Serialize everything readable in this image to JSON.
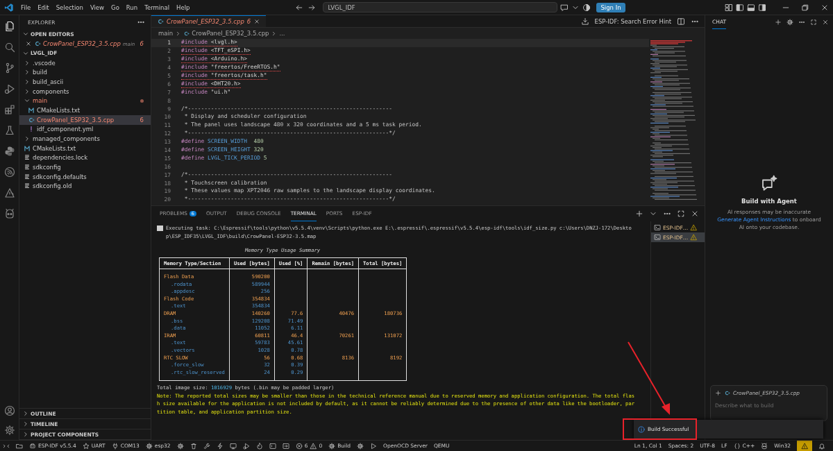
{
  "title_bar": {
    "menus": [
      "File",
      "Edit",
      "Selection",
      "View",
      "Go",
      "Run",
      "Terminal",
      "Help"
    ],
    "command_center": "LVGL_IDF",
    "sign_in": "Sign In"
  },
  "activity_bar": [
    {
      "selected": true
    },
    {
      "selected": false
    },
    {
      "selected": false
    },
    {
      "selected": false
    },
    {
      "selected": false
    },
    {
      "selected": false
    },
    {
      "selected": false
    },
    {
      "selected": false
    },
    {
      "selected": false
    },
    {
      "selected": false
    }
  ],
  "explorer": {
    "title": "EXPLORER",
    "open_editors": {
      "label": "OPEN EDITORS",
      "expanded": true,
      "items": [
        {
          "name": "CrowPanel_ESP32_3.5.cpp",
          "folder": "main",
          "badge": "6",
          "errors": true
        }
      ]
    },
    "workspace": {
      "label": "LVGL_IDF",
      "expanded": true,
      "children": [
        {
          "name": ".vscode",
          "kind": "folder",
          "expanded": false,
          "selected": false,
          "errors": false
        },
        {
          "name": "build",
          "kind": "folder",
          "expanded": false,
          "selected": false,
          "errors": false
        },
        {
          "name": "build_ascii",
          "kind": "folder",
          "expanded": false,
          "selected": false,
          "errors": false
        },
        {
          "name": "components",
          "kind": "folder",
          "expanded": false,
          "selected": false,
          "errors": false
        },
        {
          "name": "main",
          "kind": "folder",
          "expanded": true,
          "selected": false,
          "errors": true,
          "children": [
            {
              "name": "CMakeLists.txt",
              "kind": "cmake",
              "selected": false,
              "errors": false
            },
            {
              "name": "CrowPanel_ESP32_3.5.cpp",
              "kind": "cpp",
              "badge": "6",
              "selected": true,
              "errors": true
            },
            {
              "name": "idf_component.yml",
              "kind": "yaml",
              "selected": false,
              "errors": false
            }
          ]
        },
        {
          "name": "managed_components",
          "kind": "folder",
          "expanded": false,
          "selected": false,
          "errors": false
        },
        {
          "name": "CMakeLists.txt",
          "kind": "cmake",
          "selected": false,
          "errors": false
        },
        {
          "name": "dependencies.lock",
          "kind": "text",
          "selected": false,
          "errors": false
        },
        {
          "name": "sdkconfig",
          "kind": "text",
          "selected": false,
          "errors": false
        },
        {
          "name": "sdkconfig.defaults",
          "kind": "text",
          "selected": false,
          "errors": false
        },
        {
          "name": "sdkconfig.old",
          "kind": "text",
          "selected": false,
          "errors": false
        }
      ]
    },
    "sections": [
      {
        "label": "OUTLINE",
        "expanded": false
      },
      {
        "label": "TIMELINE",
        "expanded": false
      },
      {
        "label": "PROJECT COMPONENTS",
        "expanded": false
      }
    ]
  },
  "editor": {
    "tab": {
      "name": "CrowPanel_ESP32_3.5.cpp",
      "badge": "6",
      "errors": true
    },
    "hint_action": "ESP-IDF: Search Error Hint",
    "breadcrumbs": [
      "main",
      "CrowPanel_ESP32_3.5.cpp",
      "..."
    ],
    "lines": [
      {
        "number": "1",
        "current": true,
        "error": true,
        "tokens": [
          {
            "kind": "keyword",
            "text": "#include"
          },
          {
            "kind": "header",
            "text": " <lvgl.h>"
          }
        ]
      },
      {
        "number": "2",
        "current": false,
        "error": true,
        "tokens": [
          {
            "kind": "keyword",
            "text": "#include"
          },
          {
            "kind": "header",
            "text": " <TFT_eSPI.h>"
          }
        ]
      },
      {
        "number": "3",
        "current": false,
        "error": true,
        "tokens": [
          {
            "kind": "keyword",
            "text": "#include"
          },
          {
            "kind": "header",
            "text": " <Arduino.h>"
          }
        ]
      },
      {
        "number": "4",
        "current": false,
        "error": true,
        "tokens": [
          {
            "kind": "keyword",
            "text": "#include"
          },
          {
            "kind": "header",
            "text": " \"freertos/FreeRTOS.h\""
          }
        ]
      },
      {
        "number": "5",
        "current": false,
        "error": true,
        "tokens": [
          {
            "kind": "keyword",
            "text": "#include"
          },
          {
            "kind": "header",
            "text": " \"freertos/task.h\""
          }
        ]
      },
      {
        "number": "6",
        "current": false,
        "error": true,
        "tokens": [
          {
            "kind": "keyword",
            "text": "#include"
          },
          {
            "kind": "header",
            "text": " <DHT20.h>"
          }
        ]
      },
      {
        "number": "7",
        "current": false,
        "error": false,
        "tokens": [
          {
            "kind": "keyword",
            "text": "#include"
          },
          {
            "kind": "header",
            "text": " \"ui.h\""
          }
        ]
      },
      {
        "number": "8",
        "current": false
      },
      {
        "number": "9",
        "current": false,
        "error": false,
        "tokens": [
          {
            "kind": "comment",
            "text": "/*--------------------------------------------------------------"
          }
        ]
      },
      {
        "number": "10",
        "current": false,
        "error": false,
        "tokens": [
          {
            "kind": "comment",
            "text": " * Display and scheduler configuration"
          }
        ]
      },
      {
        "number": "11",
        "current": false,
        "error": false,
        "tokens": [
          {
            "kind": "comment",
            "text": " * The panel uses landscape 480 x 320 coordinates and a 5 ms task period."
          }
        ]
      },
      {
        "number": "12",
        "current": false,
        "error": false,
        "tokens": [
          {
            "kind": "comment",
            "text": " *-------------------------------------------------------------*/"
          }
        ]
      },
      {
        "number": "13",
        "current": false,
        "error": false,
        "tokens": [
          {
            "kind": "keyword",
            "text": "#define"
          },
          {
            "kind": "macro",
            "text": " SCREEN_WIDTH"
          },
          {
            "kind": "number",
            "text": "  480"
          }
        ]
      },
      {
        "number": "14",
        "current": false,
        "error": false,
        "tokens": [
          {
            "kind": "keyword",
            "text": "#define"
          },
          {
            "kind": "macro",
            "text": " SCREEN_HEIGHT"
          },
          {
            "kind": "number",
            "text": " 320"
          }
        ]
      },
      {
        "number": "15",
        "current": false,
        "error": false,
        "tokens": [
          {
            "kind": "keyword",
            "text": "#define"
          },
          {
            "kind": "macro",
            "text": " LVGL_TICK_PERIOD"
          },
          {
            "kind": "number",
            "text": " 5"
          }
        ]
      },
      {
        "number": "16",
        "current": false
      },
      {
        "number": "17",
        "current": false,
        "error": false,
        "tokens": [
          {
            "kind": "comment",
            "text": "/*--------------------------------------------------------------"
          }
        ]
      },
      {
        "number": "18",
        "current": false,
        "error": false,
        "tokens": [
          {
            "kind": "comment",
            "text": " * Touchscreen calibration"
          }
        ]
      },
      {
        "number": "19",
        "current": false,
        "error": false,
        "tokens": [
          {
            "kind": "comment",
            "text": " * These values map XPT2046 raw samples to the landscape display coordinates."
          }
        ]
      },
      {
        "number": "20",
        "current": false,
        "error": false,
        "tokens": [
          {
            "kind": "comment",
            "text": " *-------------------------------------------------------------*/"
          }
        ]
      }
    ]
  },
  "panel": {
    "tabs": [
      {
        "label": "PROBLEMS",
        "badge": "6",
        "selected": false
      },
      {
        "label": "OUTPUT",
        "selected": false
      },
      {
        "label": "DEBUG CONSOLE",
        "selected": false
      },
      {
        "label": "TERMINAL",
        "selected": true
      },
      {
        "label": "PORTS",
        "selected": false
      },
      {
        "label": "ESP-IDF",
        "selected": false
      }
    ],
    "terminal": {
      "command_lines": [
        "Executing task: C:\\Espressif\\tools\\python\\v5.5.4\\venv\\Scripts\\python.exe E:\\.espressif\\.espressif\\v5.5.4\\esp-idf\\tools\\idf_size.py c:\\Users\\DNZJ-172\\Deskto",
        "p\\ESP_IDF35\\LVGL_IDF\\build\\CrowPanel-ESP32-3.5.map"
      ],
      "table_title": "Memory Type Usage Summary",
      "columns": [
        "Memory Type/Section",
        "Used [bytes]",
        "Used [%]",
        "Remain [bytes]",
        "Total [bytes]"
      ],
      "rows": [
        {
          "kind": "group",
          "name": "Flash Data",
          "used": "590200"
        },
        {
          "kind": "section",
          "name": ".rodata",
          "used": "589944"
        },
        {
          "kind": "section",
          "name": ".appdesc",
          "used": "256"
        },
        {
          "kind": "group",
          "name": "Flash Code",
          "used": "354834"
        },
        {
          "kind": "section",
          "name": ".text",
          "used": "354834"
        },
        {
          "kind": "group",
          "name": "DRAM",
          "used": "140260",
          "used_pct": "77.6",
          "remain": "40476",
          "total": "180736"
        },
        {
          "kind": "section",
          "name": ".bss",
          "used": "129208",
          "used_pct": "71.49"
        },
        {
          "kind": "section",
          "name": ".data",
          "used": "11052",
          "used_pct": "6.11"
        },
        {
          "kind": "group",
          "name": "IRAM",
          "used": "60811",
          "used_pct": "46.4",
          "remain": "70261",
          "total": "131072"
        },
        {
          "kind": "section",
          "name": ".text",
          "used": "59783",
          "used_pct": "45.61"
        },
        {
          "kind": "section",
          "name": ".vectors",
          "used": "1028",
          "used_pct": "0.78"
        },
        {
          "kind": "group",
          "name": "RTC SLOW",
          "used": "56",
          "used_pct": "0.68",
          "remain": "8136",
          "total": "8192"
        },
        {
          "kind": "section",
          "name": ".force_slow",
          "used": "32",
          "used_pct": "0.39"
        },
        {
          "kind": "section",
          "name": ".rtc_slow_reserved",
          "used": "24",
          "used_pct": "0.29"
        }
      ],
      "total": {
        "before": "Total image size: ",
        "value": "1016929",
        "after": " bytes (.bin may be padded larger)"
      },
      "note_lines": [
        "Note: The reported total sizes may be smaller than those in the technical reference manual due to reserved memory and application configuration. The total flas",
        "h size available for the application is not included by default, as it cannot be reliably determined due to the presence of other data like the bootloader, par",
        "tition table, and application partition size."
      ]
    },
    "terminals": [
      {
        "label": "ESP-IDF…",
        "selected": false
      },
      {
        "label": "ESP-IDF…",
        "selected": true
      }
    ]
  },
  "chat": {
    "tabs": [
      {
        "label": "CHAT",
        "selected": true
      }
    ],
    "empty_title": "Build with Agent",
    "notice": "AI responses may be inaccurate",
    "link": "Generate Agent Instructions",
    "link_after": " to onboard AI onto your codebase.",
    "attachment": "CrowPanel_ESP32_3.5.cpp",
    "placeholder": "Describe what to build"
  },
  "toast": {
    "message": "Build Successful"
  },
  "status_bar": {
    "left": [
      "ESP-IDF v5.5.4",
      "UART",
      "COM13",
      "esp32"
    ],
    "errors": "6",
    "warnings": "0",
    "build": "Build",
    "servers": [
      "OpenOCD Server",
      "QEMU"
    ],
    "right": [
      "Ln 1, Col 1",
      "Spaces: 2",
      "UTF-8",
      "LF",
      "C++",
      "Win32"
    ]
  }
}
